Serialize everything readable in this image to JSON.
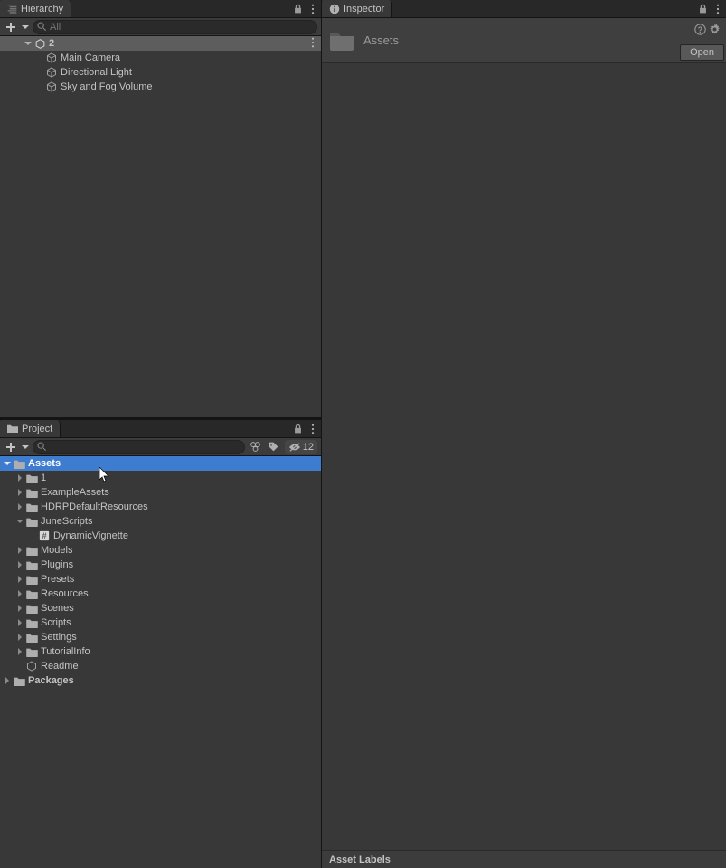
{
  "hierarchy": {
    "title": "Hierarchy",
    "search_placeholder": "All",
    "scene": "2",
    "items": [
      "Main Camera",
      "Directional Light",
      "Sky and Fog Volume"
    ]
  },
  "project": {
    "title": "Project",
    "hidden_count": "12",
    "tree": [
      {
        "label": "Assets",
        "depth": 0,
        "icon": "folder",
        "expanded": true,
        "selected": true,
        "bold": true
      },
      {
        "label": "1",
        "depth": 1,
        "icon": "folder",
        "arrow": true
      },
      {
        "label": "ExampleAssets",
        "depth": 1,
        "icon": "folder",
        "arrow": true
      },
      {
        "label": "HDRPDefaultResources",
        "depth": 1,
        "icon": "folder",
        "arrow": true
      },
      {
        "label": "JuneScripts",
        "depth": 1,
        "icon": "folder",
        "expanded": true
      },
      {
        "label": "DynamicVignette",
        "depth": 2,
        "icon": "script"
      },
      {
        "label": "Models",
        "depth": 1,
        "icon": "folder",
        "arrow": true
      },
      {
        "label": "Plugins",
        "depth": 1,
        "icon": "folder",
        "arrow": true
      },
      {
        "label": "Presets",
        "depth": 1,
        "icon": "folder",
        "arrow": true
      },
      {
        "label": "Resources",
        "depth": 1,
        "icon": "folder",
        "arrow": true
      },
      {
        "label": "Scenes",
        "depth": 1,
        "icon": "folder",
        "arrow": true
      },
      {
        "label": "Scripts",
        "depth": 1,
        "icon": "folder",
        "arrow": true
      },
      {
        "label": "Settings",
        "depth": 1,
        "icon": "folder",
        "arrow": true
      },
      {
        "label": "TutorialInfo",
        "depth": 1,
        "icon": "folder",
        "arrow": true
      },
      {
        "label": "Readme",
        "depth": 1,
        "icon": "asset"
      },
      {
        "label": "Packages",
        "depth": 0,
        "icon": "folder",
        "arrow": true,
        "bold": true
      }
    ]
  },
  "inspector": {
    "title": "Inspector",
    "asset_name": "Assets",
    "open": "Open",
    "labels": "Asset Labels"
  }
}
